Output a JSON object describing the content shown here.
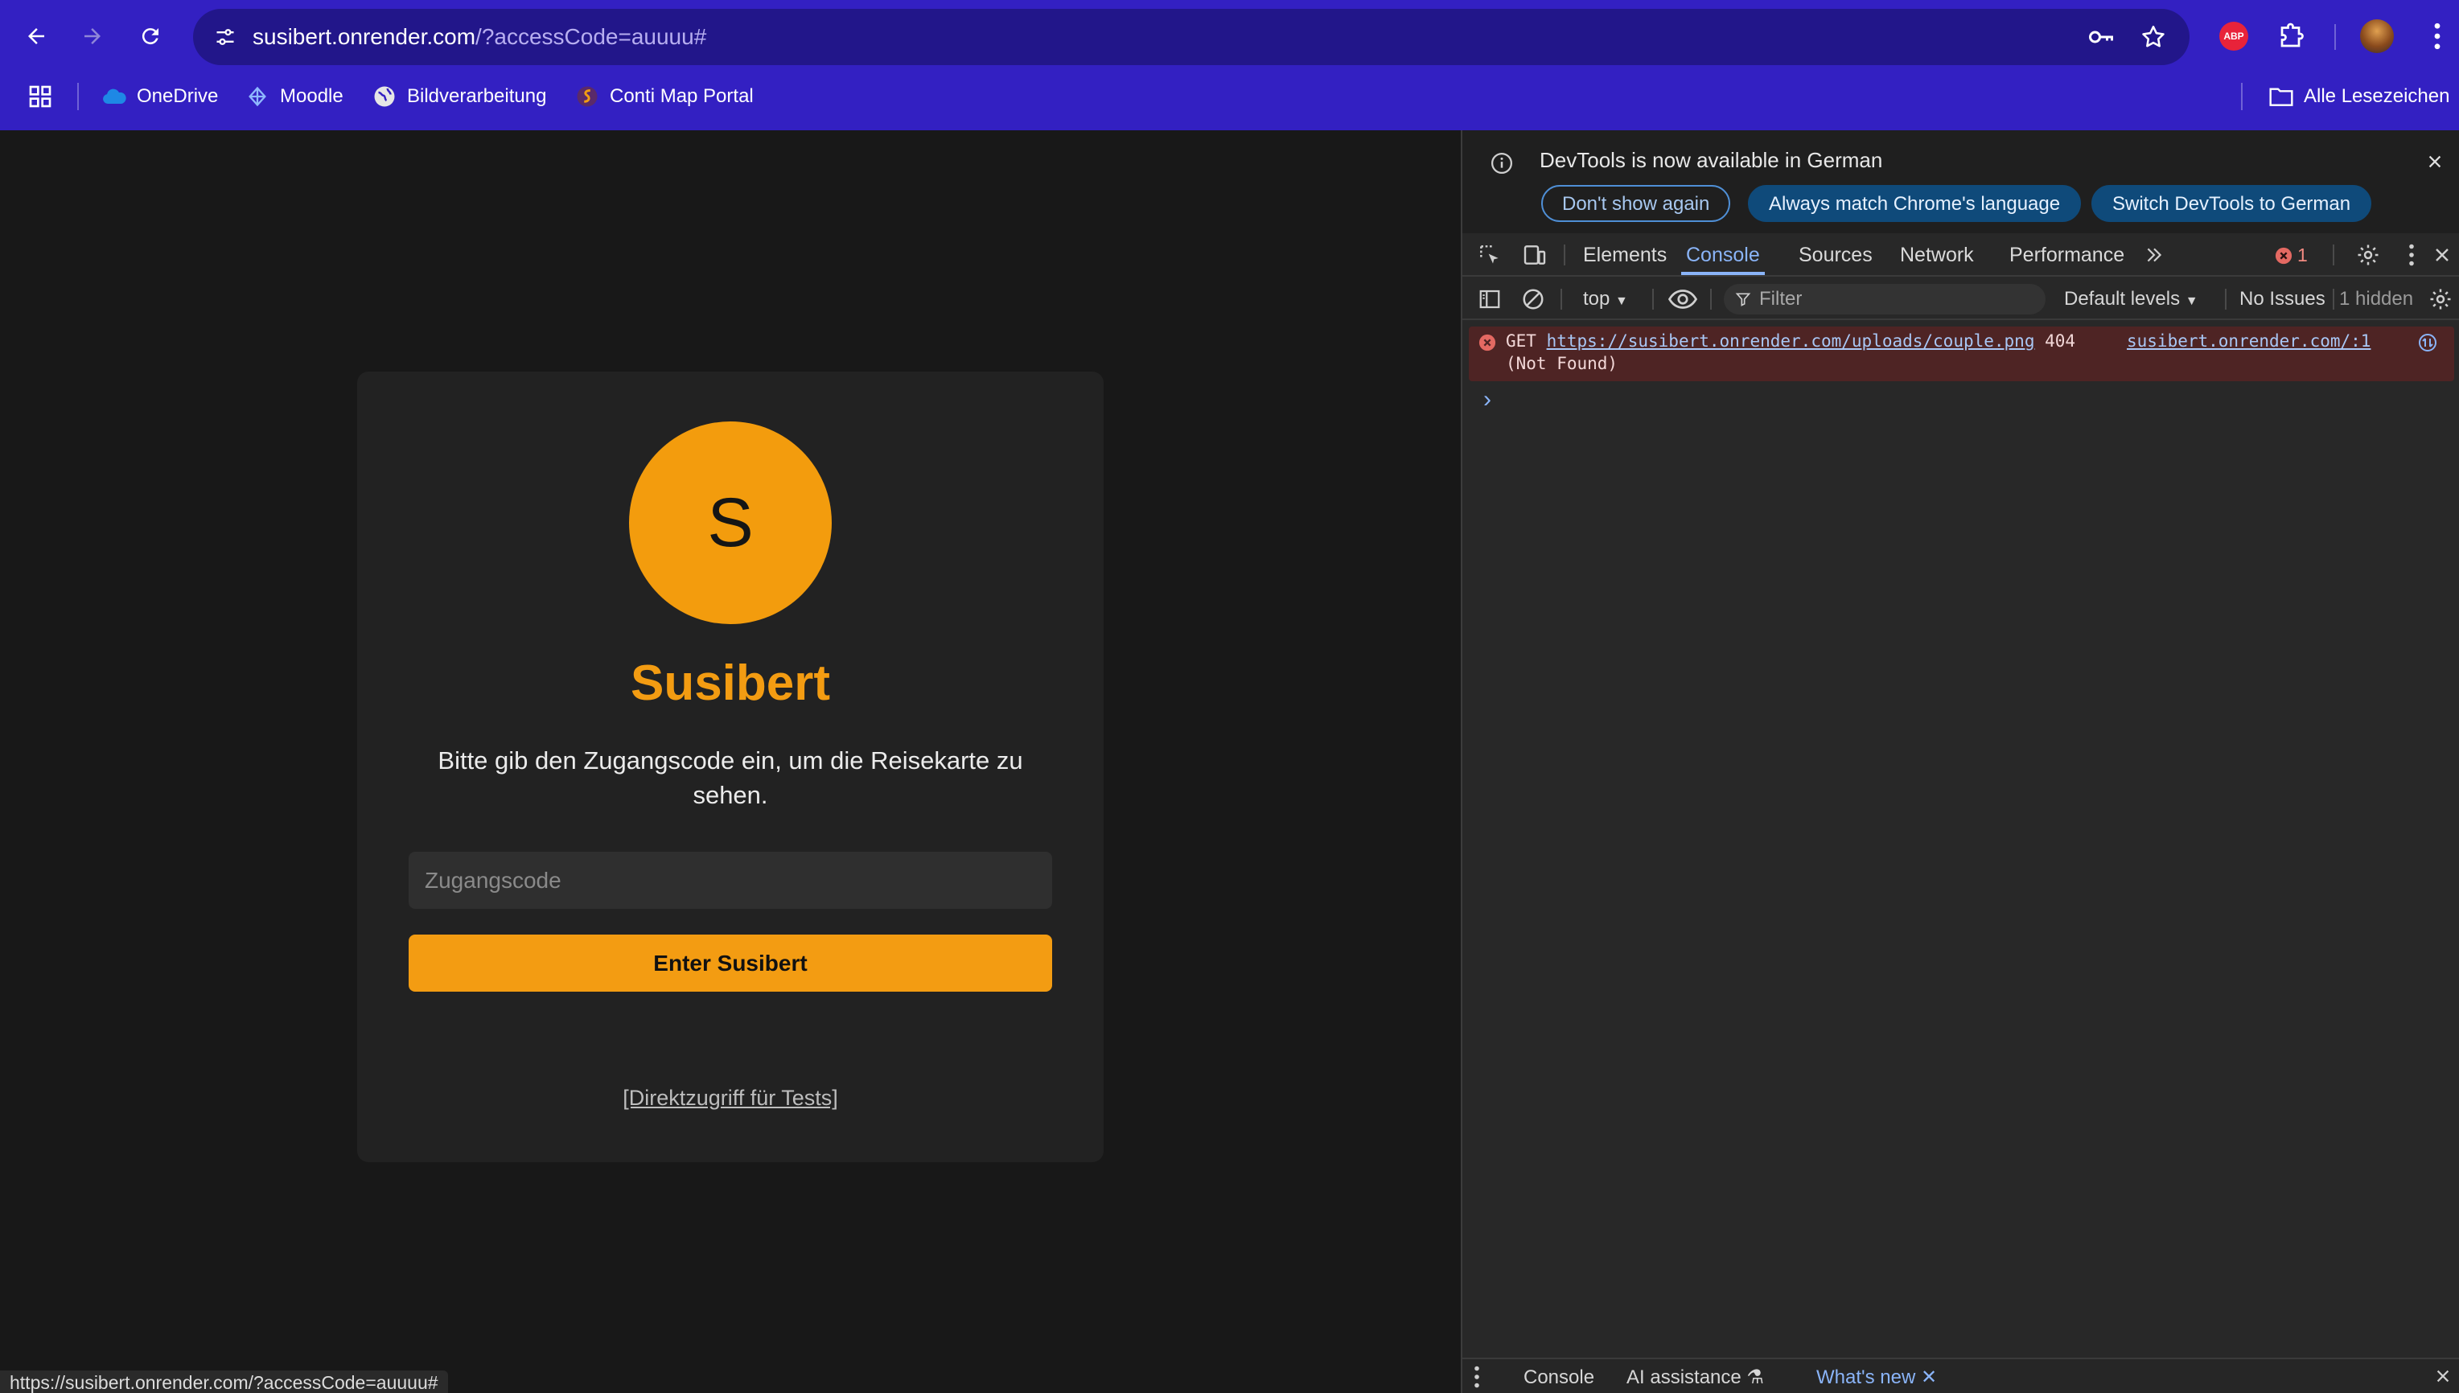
{
  "browser": {
    "url_host": "susibert.onrender.com",
    "url_rest": "/?accessCode=auuuu#",
    "extension_badge": "ABP"
  },
  "bookmarks": {
    "items": [
      {
        "label": "OneDrive",
        "icon": "onedrive-icon"
      },
      {
        "label": "Moodle",
        "icon": "moodle-icon"
      },
      {
        "label": "Bildverarbeitung",
        "icon": "globe-icon"
      },
      {
        "label": "Conti Map Portal",
        "icon": "conti-icon"
      }
    ],
    "all_bookmarks_label": "Alle Lesezeichen"
  },
  "page": {
    "avatar_letter": "S",
    "brand": "Susibert",
    "subtitle": "Bitte gib den Zugangscode ein, um die Reisekarte zu sehen.",
    "input_placeholder": "Zugangscode",
    "enter_button": "Enter Susibert",
    "direct_access_link": "[Direktzugriff für Tests]",
    "status_url": "https://susibert.onrender.com/?accessCode=auuuu#",
    "accent_color": "#f39c12"
  },
  "devtools": {
    "info_text": "DevTools is now available in German",
    "pill_dont_show": "Don't show again",
    "pill_match_language": "Always match Chrome's language",
    "pill_switch": "Switch DevTools to German",
    "tabs": [
      "Elements",
      "Console",
      "Sources",
      "Network",
      "Performance"
    ],
    "active_tab": "Console",
    "error_count": "1",
    "toolbar": {
      "context": "top",
      "filter_placeholder": "Filter",
      "levels": "Default levels",
      "issues": "No Issues",
      "hidden": "1 hidden"
    },
    "console_error": {
      "method": "GET",
      "url": "https://susibert.onrender.com/uploads/couple.png",
      "status": "404",
      "status_text": "(Not Found)",
      "source": "susibert.onrender.com/:1"
    },
    "prompt_symbol": "›",
    "bottom_tabs": {
      "console": "Console",
      "ai": "AI assistance",
      "whats_new": "What's new"
    }
  }
}
